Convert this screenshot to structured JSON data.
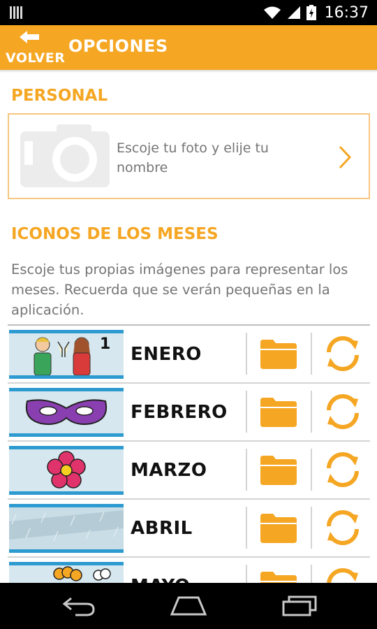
{
  "status_bar": {
    "time": "16:37",
    "icons": [
      "signal-bars-icon",
      "wifi-icon",
      "cell-signal-icon",
      "battery-charging-icon"
    ]
  },
  "app_bar": {
    "back_label": "VOLVER",
    "title": "OPCIONES",
    "color": "#f5a623"
  },
  "personal": {
    "section_title": "PERSONAL",
    "card_text": "Escoje tu foto y elije tu nombre"
  },
  "months_section": {
    "section_title": "ICONOS DE LOS MESES",
    "description": "Escoje tus propias imágenes para representar los meses. Recuerda que se verán pequeñas en la aplicación.",
    "months": [
      {
        "name": "ENERO",
        "thumb_number": "1"
      },
      {
        "name": "FEBRERO"
      },
      {
        "name": "MARZO"
      },
      {
        "name": "ABRIL"
      },
      {
        "name": "MAYO"
      }
    ]
  },
  "nav_bar": {
    "icons": [
      "back-nav-icon",
      "home-nav-icon",
      "recents-nav-icon"
    ]
  }
}
